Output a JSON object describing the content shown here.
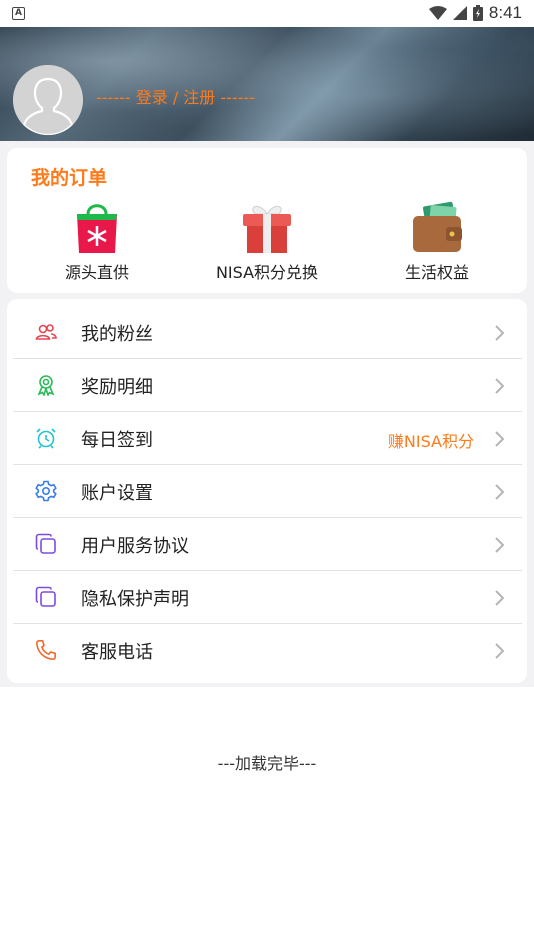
{
  "status_bar": {
    "time": "8:41",
    "app_icon_letter": "A"
  },
  "header": {
    "login_text": "------ 登录 / 注册 ------"
  },
  "orders": {
    "title": "我的订单",
    "items": [
      {
        "label": "源头直供",
        "icon": "shopping-bag-icon"
      },
      {
        "label": "NISA积分兑换",
        "icon": "gift-box-icon"
      },
      {
        "label": "生活权益",
        "icon": "wallet-icon"
      }
    ]
  },
  "menu": {
    "items": [
      {
        "label": "我的粉丝",
        "icon": "fans-icon",
        "extra": ""
      },
      {
        "label": "奖励明细",
        "icon": "award-ribbon-icon",
        "extra": ""
      },
      {
        "label": "每日签到",
        "icon": "alarm-clock-icon",
        "extra": "赚NISA积分"
      },
      {
        "label": "账户设置",
        "icon": "settings-gear-icon",
        "extra": ""
      },
      {
        "label": "用户服务协议",
        "icon": "document-copy-icon",
        "extra": ""
      },
      {
        "label": "隐私保护声明",
        "icon": "document-copy-icon",
        "extra": ""
      },
      {
        "label": "客服电话",
        "icon": "phone-icon",
        "extra": ""
      }
    ]
  },
  "footer": {
    "text": "---加载完毕---"
  },
  "colors": {
    "accent": "#ff7a1a",
    "fans": "#e8464e",
    "award": "#2dbb5a",
    "clock": "#22c3d8",
    "settings": "#3b7de8",
    "document": "#7b4be0",
    "phone": "#f26a2a"
  }
}
